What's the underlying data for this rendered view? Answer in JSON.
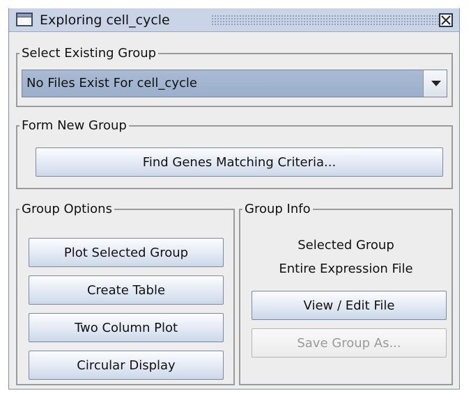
{
  "window": {
    "title": "Exploring cell_cycle"
  },
  "select_group": {
    "legend": "Select Existing Group",
    "selected": "No Files Exist For cell_cycle"
  },
  "form_group": {
    "legend": "Form New Group",
    "find_label": "Find Genes Matching Criteria..."
  },
  "group_options": {
    "legend": "Group Options",
    "buttons": [
      "Plot Selected Group",
      "Create Table",
      "Two Column Plot",
      "Circular Display"
    ]
  },
  "group_info": {
    "legend": "Group Info",
    "line1": "Selected Group",
    "line2": "Entire Expression File",
    "view_edit_label": "View / Edit File",
    "save_as_label": "Save Group As..."
  },
  "icons": [
    "window-icon",
    "close-icon",
    "chevron-down-icon"
  ]
}
